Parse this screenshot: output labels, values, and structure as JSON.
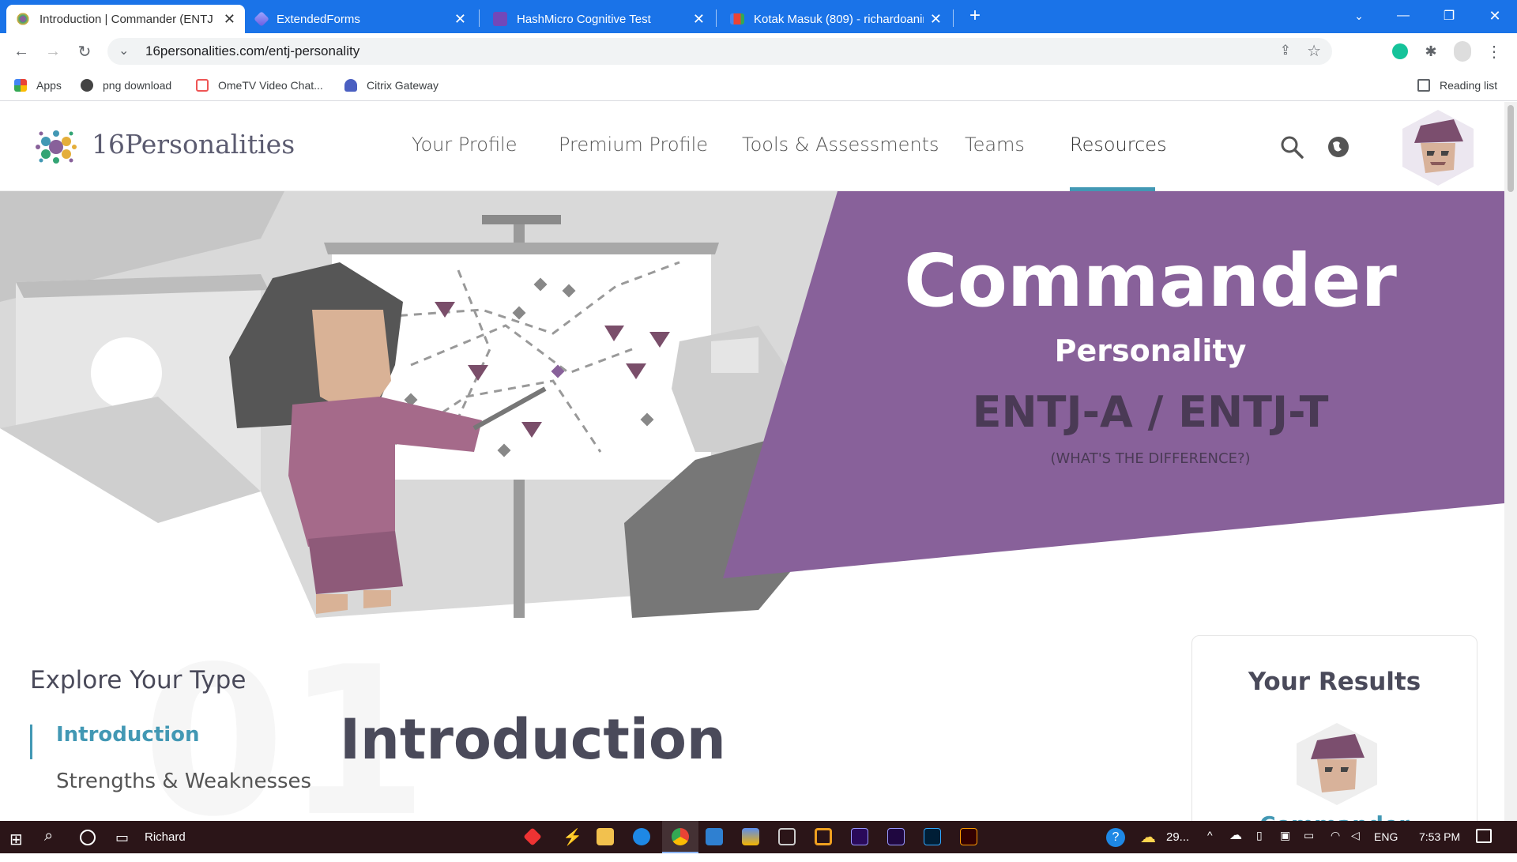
{
  "browser": {
    "tabs": [
      {
        "title": "Introduction | Commander (ENTJ",
        "active": true
      },
      {
        "title": "ExtendedForms",
        "active": false
      },
      {
        "title": "HashMicro Cognitive Test",
        "active": false
      },
      {
        "title": "Kotak Masuk (809) - richardoanin",
        "active": false
      }
    ],
    "url": "16personalities.com/entj-personality",
    "bookmarks": [
      "Apps",
      "png download",
      "OmeTV Video Chat...",
      "Citrix Gateway"
    ],
    "reading_list": "Reading list"
  },
  "site": {
    "logo": "16Personalities",
    "nav": [
      "Your Profile",
      "Premium Profile",
      "Tools & Assessments",
      "Teams",
      "Resources"
    ],
    "active_nav": "Resources"
  },
  "hero": {
    "title": "Commander",
    "subtitle": "Personality",
    "type_code": "ENTJ-A / ENTJ-T",
    "difference_link": "(WHAT'S THE DIFFERENCE?)",
    "accent_color": "#88619a"
  },
  "sidebar": {
    "heading": "Explore Your Type",
    "items": [
      "Introduction",
      "Strengths & Weaknesses"
    ],
    "active": "Introduction"
  },
  "main": {
    "section_number": "01",
    "heading": "Introduction"
  },
  "results": {
    "heading": "Your Results",
    "type_name": "Commander"
  },
  "taskbar": {
    "user": "Richard",
    "weather": "29...",
    "language": "ENG",
    "time": "7:53 PM"
  }
}
